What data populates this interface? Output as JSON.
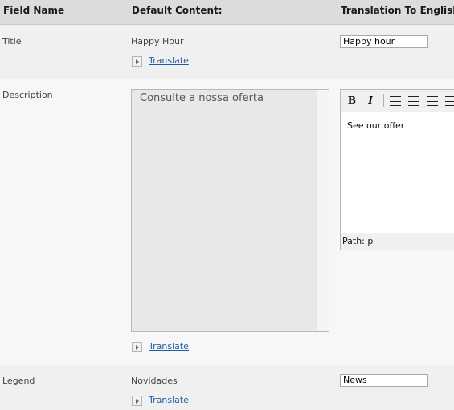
{
  "header": {
    "field_name": "Field Name",
    "default_content": "Default Content:",
    "translation": "Translation To English"
  },
  "rows": {
    "title": {
      "label": "Title",
      "default_value": "Happy Hour",
      "translate_link": "Translate",
      "translation_value": "Happy hour"
    },
    "description": {
      "label": "Description",
      "default_value": "Consulte a nossa oferta",
      "translate_link": "Translate",
      "editor": {
        "bold": "B",
        "italic": "I",
        "content": "See our offer",
        "path": "Path: p"
      }
    },
    "legend": {
      "label": "Legend",
      "default_value": "Novidades",
      "translate_link": "Translate",
      "translation_value": "News"
    }
  }
}
